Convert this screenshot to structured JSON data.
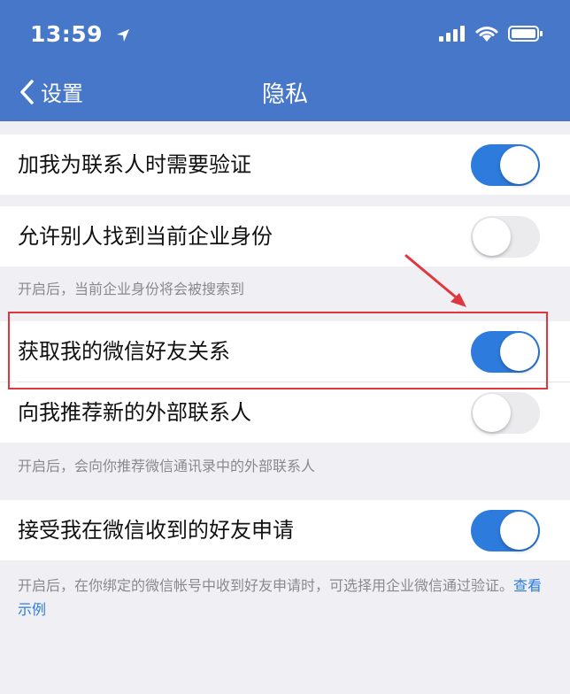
{
  "status_bar": {
    "time": "13:59"
  },
  "nav": {
    "back_label": "设置",
    "title": "隐私"
  },
  "settings": [
    {
      "label": "加我为联系人时需要验证",
      "enabled": true
    },
    {
      "label": "允许别人找到当前企业身份",
      "enabled": false
    },
    {
      "label": "获取我的微信好友关系",
      "enabled": true
    },
    {
      "label": "向我推荐新的外部联系人",
      "enabled": false
    },
    {
      "label": "接受我在微信收到的好友申请",
      "enabled": true
    }
  ],
  "notes": {
    "enterprise_identity": "开启后，当前企业身份将会被搜索到",
    "recommend": "开启后，会向你推荐微信通讯录中的外部联系人",
    "friend_request": "开启后，在你绑定的微信帐号中收到好友申请时，可选择用企业微信通过验证。",
    "friend_request_link": "查看示例"
  },
  "colors": {
    "header": "#4677c9",
    "toggle_on": "#2d7bdc",
    "highlight": "#e0363e"
  }
}
